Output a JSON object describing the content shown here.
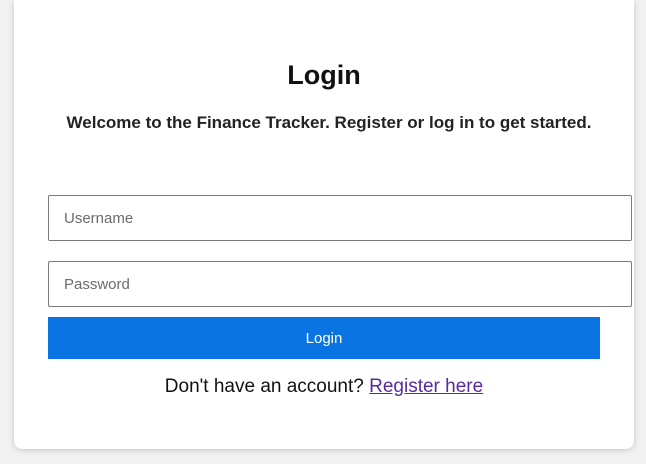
{
  "login": {
    "title": "Login",
    "subtitle": "Welcome to the Finance Tracker. Register or log in to get started.",
    "username_placeholder": "Username",
    "password_placeholder": "Password",
    "login_button_label": "Login",
    "register_prompt": "Don't have an account? ",
    "register_link_label": "Register here"
  },
  "colors": {
    "primary_button": "#0a75e2",
    "link_visited": "#5a2a9e",
    "background": "#f1f1f1"
  }
}
